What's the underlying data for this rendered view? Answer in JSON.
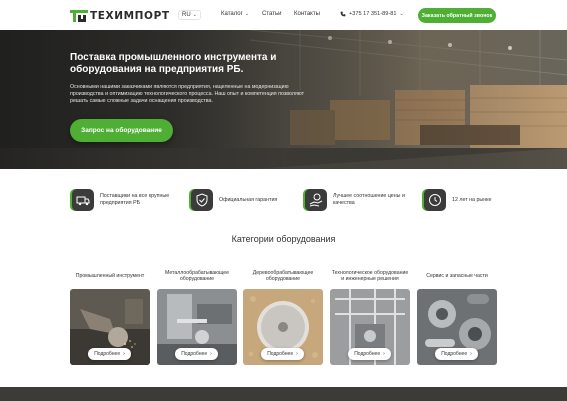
{
  "header": {
    "logo_text": "ТЕХИМПОРТ",
    "lang": "RU",
    "nav": {
      "catalog": "Каталог",
      "articles": "Статьи",
      "contacts": "Контакты"
    },
    "phone": "+375 17 351-89-81",
    "callback_label": "Заказать обратный звонок"
  },
  "hero": {
    "title": "Поставка промышленного инструмента и оборудования  на предприятия РБ.",
    "text": "Основными нашими заказчиками являются предприятия, нацеленные на модернизацию производства и оптимизацию технологического процесса. Наш опыт и компетенция позволяют решать самые сложные задачи оснащения производства.",
    "cta_label": "Запрос на оборудование"
  },
  "features": [
    {
      "icon": "truck-icon",
      "text": "Поставщики на все крупные предприятия РБ"
    },
    {
      "icon": "shield-icon",
      "text": "Официальная гарантия"
    },
    {
      "icon": "price-hand-icon",
      "text": "Лучшее соотношение цены и качества"
    },
    {
      "icon": "clock-icon",
      "text": "12 лет на рынке"
    }
  ],
  "categories": {
    "title": "Категории оборудования",
    "more_label": "Подробнее",
    "items": [
      {
        "title": "Промышленный инструмент"
      },
      {
        "title": "Металлообрабатывающее оборудование"
      },
      {
        "title": "Деревообрабатывающее оборудование"
      },
      {
        "title": "Технологическое оборудование и инженерные решения"
      },
      {
        "title": "Сервис и запасные части"
      }
    ]
  },
  "colors": {
    "accent": "#4fae34",
    "dark": "#3b3b3b"
  }
}
